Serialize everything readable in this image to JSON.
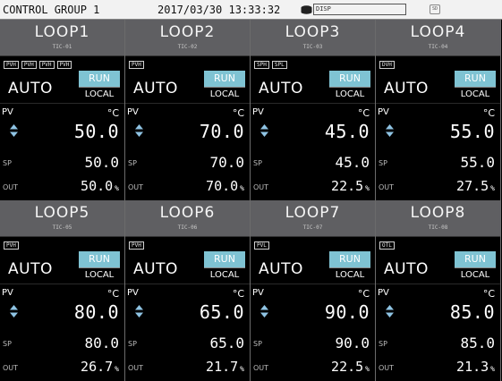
{
  "status_bar": {
    "group": "CONTROL GROUP 1",
    "datetime": "2017/03/30 13:33:32",
    "media_icon": "storage-media-icon",
    "disp_label": "DISP",
    "tag_label": "SD"
  },
  "colors": {
    "header_bg": "#5f5f62",
    "run_bg": "#7fc3d3",
    "status_bg": "#f2f2f2"
  },
  "loops": [
    {
      "name": "LOOP1",
      "tag": "TIC-01",
      "alarms": [
        "PVH",
        "PVH",
        "PVH",
        "PVH"
      ],
      "mode": "AUTO",
      "run": "RUN",
      "local": "LOCAL",
      "pv_label": "PV",
      "unit": "°C",
      "pv": "50.0",
      "sp_label": "SP",
      "sp": "50.0",
      "out_label": "OUT",
      "out": "50.0",
      "out_unit": "%"
    },
    {
      "name": "LOOP2",
      "tag": "TIC-02",
      "alarms": [
        "PVH"
      ],
      "mode": "AUTO",
      "run": "RUN",
      "local": "LOCAL",
      "pv_label": "PV",
      "unit": "°C",
      "pv": "70.0",
      "sp_label": "SP",
      "sp": "70.0",
      "out_label": "OUT",
      "out": "70.0",
      "out_unit": "%"
    },
    {
      "name": "LOOP3",
      "tag": "TIC-03",
      "alarms": [
        "SPH",
        "SPL"
      ],
      "mode": "AUTO",
      "run": "RUN",
      "local": "LOCAL",
      "pv_label": "PV",
      "unit": "°C",
      "pv": "45.0",
      "sp_label": "SP",
      "sp": "45.0",
      "out_label": "OUT",
      "out": "22.5",
      "out_unit": "%"
    },
    {
      "name": "LOOP4",
      "tag": "TIC-04",
      "alarms": [
        "DVH"
      ],
      "mode": "AUTO",
      "run": "RUN",
      "local": "LOCAL",
      "pv_label": "PV",
      "unit": "°C",
      "pv": "55.0",
      "sp_label": "SP",
      "sp": "55.0",
      "out_label": "OUT",
      "out": "27.5",
      "out_unit": "%"
    },
    {
      "name": "LOOP5",
      "tag": "TIC-05",
      "alarms": [
        "PVH"
      ],
      "mode": "AUTO",
      "run": "RUN",
      "local": "LOCAL",
      "pv_label": "PV",
      "unit": "°C",
      "pv": "80.0",
      "sp_label": "SP",
      "sp": "80.0",
      "out_label": "OUT",
      "out": "26.7",
      "out_unit": "%"
    },
    {
      "name": "LOOP6",
      "tag": "TIC-06",
      "alarms": [
        "PVH"
      ],
      "mode": "AUTO",
      "run": "RUN",
      "local": "LOCAL",
      "pv_label": "PV",
      "unit": "°C",
      "pv": "65.0",
      "sp_label": "SP",
      "sp": "65.0",
      "out_label": "OUT",
      "out": "21.7",
      "out_unit": "%"
    },
    {
      "name": "LOOP7",
      "tag": "TIC-07",
      "alarms": [
        "PVL"
      ],
      "mode": "AUTO",
      "run": "RUN",
      "local": "LOCAL",
      "pv_label": "PV",
      "unit": "°C",
      "pv": "90.0",
      "sp_label": "SP",
      "sp": "90.0",
      "out_label": "OUT",
      "out": "22.5",
      "out_unit": "%"
    },
    {
      "name": "LOOP8",
      "tag": "TIC-08",
      "alarms": [
        "OTL"
      ],
      "mode": "AUTO",
      "run": "RUN",
      "local": "LOCAL",
      "pv_label": "PV",
      "unit": "°C",
      "pv": "85.0",
      "sp_label": "SP",
      "sp": "85.0",
      "out_label": "OUT",
      "out": "21.3",
      "out_unit": "%"
    }
  ]
}
